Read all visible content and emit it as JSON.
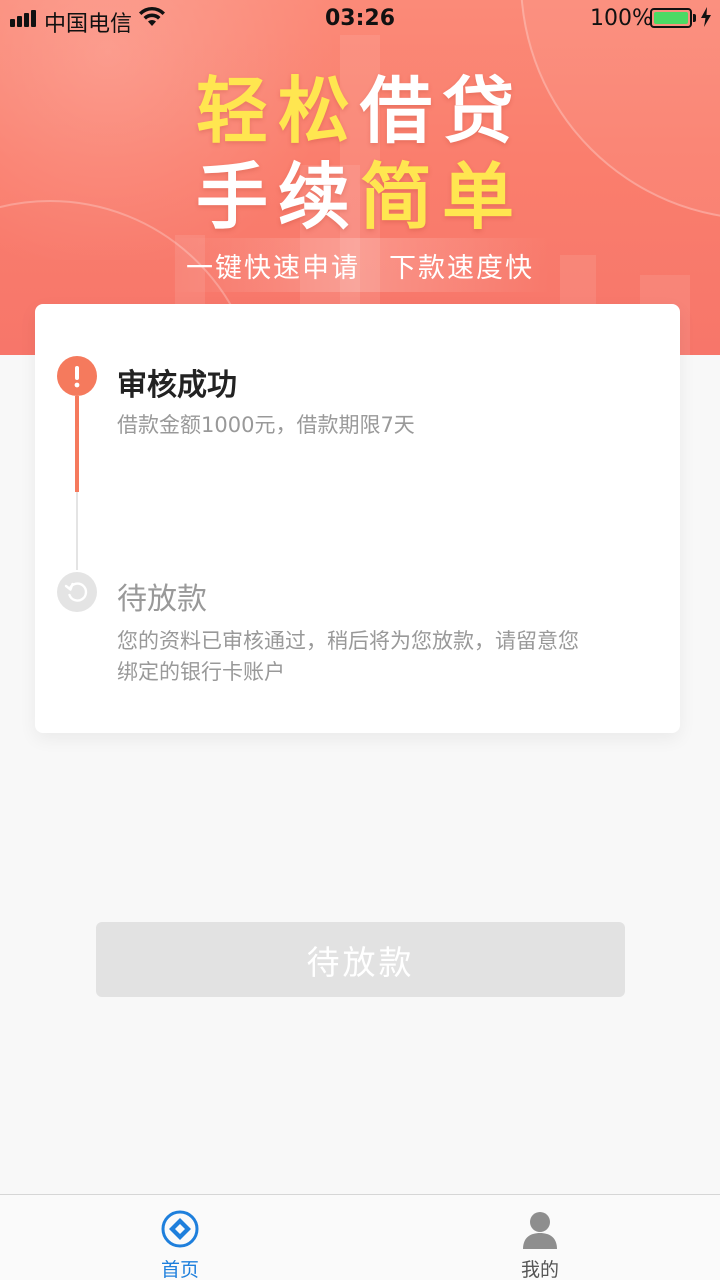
{
  "status_bar": {
    "carrier": "中国电信",
    "time": "03:26",
    "battery": "100%"
  },
  "banner": {
    "headline_line1_a": "轻松",
    "headline_line1_b": "借贷",
    "headline_line2_a": "手续",
    "headline_line2_b": "简单",
    "tagline_left": "一键快速申请",
    "tagline_right": "下款速度快"
  },
  "steps": [
    {
      "title": "审核成功",
      "description": "借款金额1000元，借款期限7天",
      "status": "done",
      "icon": "exclamation-icon",
      "icon_symbol": "!"
    },
    {
      "title": "待放款",
      "description": "您的资料已审核通过，稍后将为您放款，请留意您绑定的银行卡账户",
      "status": "pending",
      "icon": "refresh-icon"
    }
  ],
  "action_button": {
    "label": "待放款",
    "state": "disabled"
  },
  "tab_bar": {
    "items": [
      {
        "label": "首页",
        "icon": "home-diamond-icon",
        "active": true
      },
      {
        "label": "我的",
        "icon": "user-icon",
        "active": false
      }
    ]
  },
  "colors": {
    "accent": "#f57a5d",
    "tab_active": "#1e7fdc",
    "headline_yellow": "#ffe650",
    "button_disabled": "#e2e2e2"
  }
}
